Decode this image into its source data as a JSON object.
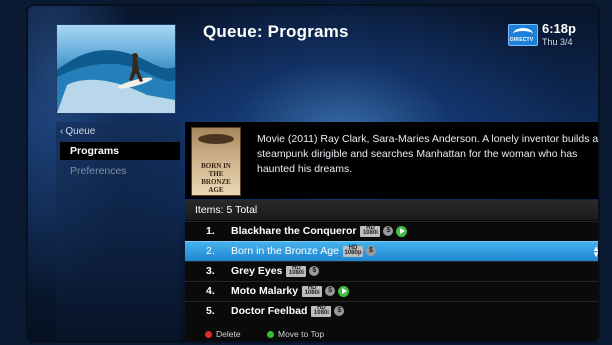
{
  "header": {
    "title": "Queue: Programs",
    "brand": "DIRECTV",
    "time": "6:18p",
    "date": "Thu 3/4"
  },
  "sidebar": {
    "back_label": "Queue",
    "items": [
      {
        "label": "Programs",
        "selected": true
      },
      {
        "label": "Preferences",
        "selected": false
      }
    ]
  },
  "detail": {
    "poster_title": "BORN IN THE BRONZE AGE",
    "synopsis": "Movie (2011) Ray Clark, Sara-Maries Anderson. A lonely inventor builds a steampunk dirigible and searches Manhattan for the woman who has haunted his dreams."
  },
  "list": {
    "header": "Items: 5 Total",
    "rows": [
      {
        "num": "1.",
        "name": "Blackhare the Conqueror",
        "hd": "HD 1080i",
        "icons": [
          "dollar",
          "play"
        ]
      },
      {
        "num": "2.",
        "name": "Born in the Bronze Age",
        "hd": "HD 1080p",
        "icons": [
          "dollar"
        ],
        "selected": true
      },
      {
        "num": "3.",
        "name": "Grey Eyes",
        "hd": "HD 1080i",
        "icons": [
          "dollar"
        ]
      },
      {
        "num": "4.",
        "name": "Moto Malarky",
        "hd": "HD 1080i",
        "icons": [
          "dollar",
          "play"
        ]
      },
      {
        "num": "5.",
        "name": "Doctor Feelbad",
        "hd": "HD 1080i",
        "icons": [
          "dollar"
        ]
      }
    ]
  },
  "legend": {
    "delete_label": "Delete",
    "move_label": "Move to Top"
  },
  "colors": {
    "selection_blue": "#2a97dc",
    "delete_red": "#e02a2a",
    "action_green": "#2fbf2f"
  }
}
